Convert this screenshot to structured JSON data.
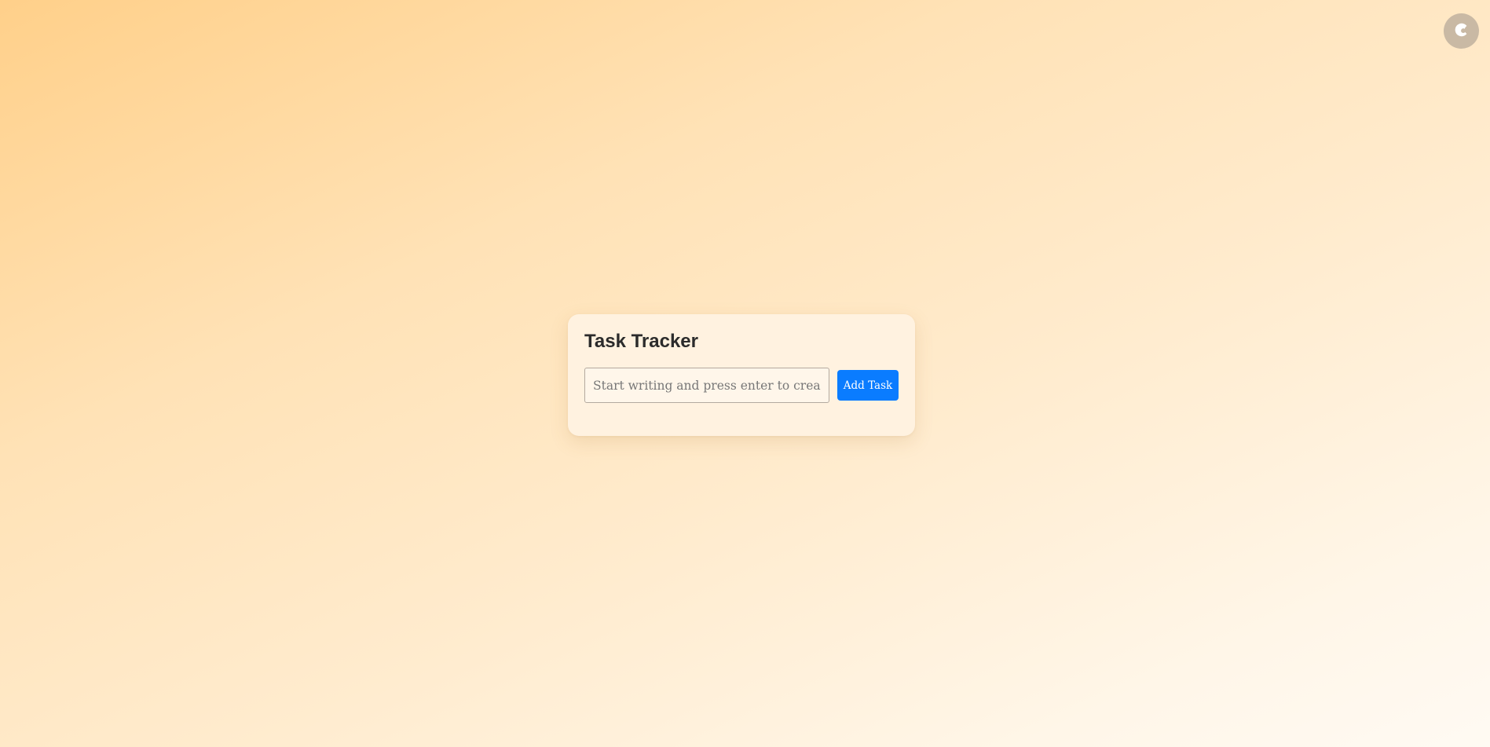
{
  "corner_button": {
    "icon": "moon-icon"
  },
  "card": {
    "title": "Task Tracker",
    "input": {
      "value": "",
      "placeholder": "Start writing and press enter to create"
    },
    "add_button_label": "Add Task"
  },
  "colors": {
    "accent": "#0a7cff",
    "card_background": "#fff2e0",
    "corner_button": "#c9b9a4"
  }
}
